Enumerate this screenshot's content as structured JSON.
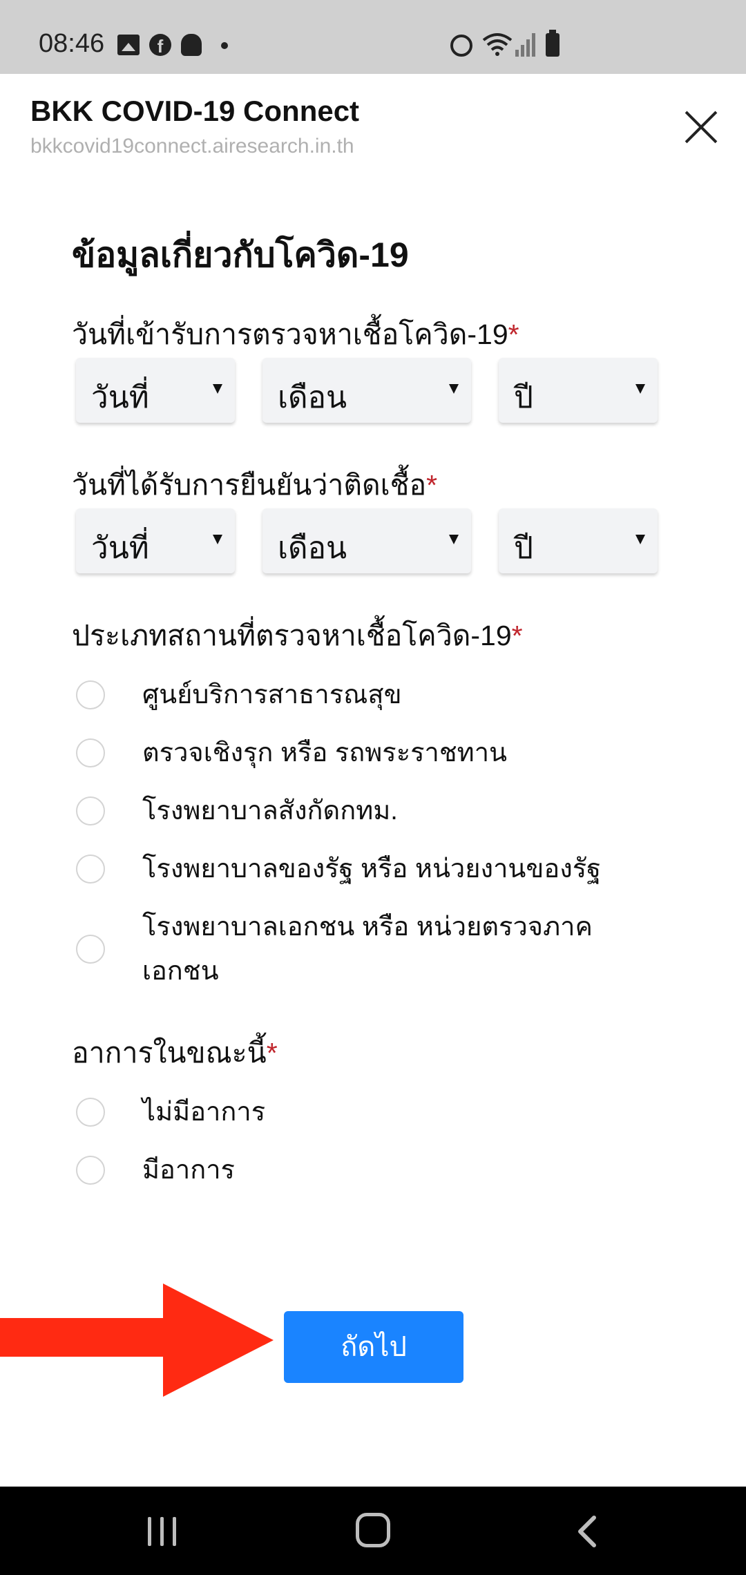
{
  "status_bar": {
    "time": "08:46",
    "left_icons": [
      "gallery-icon",
      "facebook-icon",
      "app-notification-icon",
      "dot-icon"
    ],
    "right_icons": [
      "alarm-icon",
      "wifi-icon",
      "signal-icon",
      "battery-icon"
    ]
  },
  "header": {
    "title": "BKK COVID-19 Connect",
    "url": "bkkcovid19connect.airesearch.in.th"
  },
  "form": {
    "title": "ข้อมูลเกี่ยวกับโควิด-19",
    "test_date": {
      "label": "วันที่เข้ารับการตรวจหาเชื้อโควิด-19",
      "required_mark": "*",
      "day": "วันที่",
      "month": "เดือน",
      "year": "ปี"
    },
    "confirm_date": {
      "label": "วันที่ได้รับการยืนยันว่าติดเชื้อ",
      "required_mark": "*",
      "day": "วันที่",
      "month": "เดือน",
      "year": "ปี"
    },
    "test_place": {
      "label": "ประเภทสถานที่ตรวจหาเชื้อโควิด-19",
      "required_mark": "*",
      "options": [
        "ศูนย์บริการสาธารณสุข",
        "ตรวจเชิงรุก หรือ รถพระราชทาน",
        "โรงพยาบาลสังกัดกทม.",
        "โรงพยาบาลของรัฐ หรือ หน่วยงานของรัฐ",
        "โรงพยาบาลเอกชน หรือ หน่วยตรวจภาค\nเอกชน"
      ]
    },
    "symptoms": {
      "label": "อาการในขณะนี้",
      "required_mark": "*",
      "options": [
        "ไม่มีอาการ",
        "มีอาการ"
      ]
    },
    "next_label": "ถัดไป"
  },
  "colors": {
    "accent": "#1a84ff",
    "required": "#c0262d",
    "arrow": "#ff2a12"
  }
}
